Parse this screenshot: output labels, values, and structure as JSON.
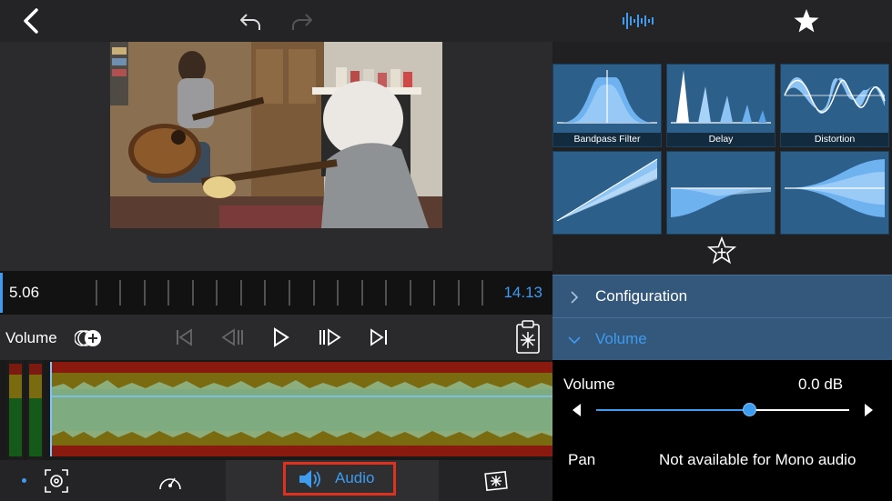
{
  "topbar": {
    "back_icon": "chevron-left-icon",
    "undo_icon": "undo-icon",
    "redo_icon": "redo-icon",
    "audio_fx_icon": "waveform-icon",
    "favorite_icon": "star-icon"
  },
  "effects": {
    "tiles": [
      {
        "label": "Bandpass Filter",
        "icon": "bandpass-graph"
      },
      {
        "label": "Delay",
        "icon": "delay-graph"
      },
      {
        "label": "Distortion",
        "icon": "distortion-graph"
      },
      {
        "label": "",
        "icon": "compressor-graph"
      },
      {
        "label": "",
        "icon": "fade-graph"
      },
      {
        "label": "",
        "icon": "spread-graph"
      }
    ],
    "add_favorite_icon": "star-plus-icon"
  },
  "timeline": {
    "start_time": "5.06",
    "end_time": "14.13"
  },
  "controls": {
    "volume_label": "Volume",
    "volume_toggle_icon": "add-volume-icon",
    "skip_start_icon": "skip-to-start-icon",
    "step_back_icon": "step-back-icon",
    "play_icon": "play-icon",
    "step_forward_icon": "step-forward-icon",
    "skip_end_icon": "skip-to-end-icon",
    "clipboard_icon": "clipboard-icon"
  },
  "bottombar": {
    "tabs": [
      {
        "icon": "framing-icon",
        "label": ""
      },
      {
        "icon": "speed-icon",
        "label": ""
      },
      {
        "icon": "speaker-icon",
        "label": "Audio"
      },
      {
        "icon": "effects-icon",
        "label": ""
      }
    ]
  },
  "settings": {
    "sections": [
      {
        "label": "Configuration",
        "expanded": false
      },
      {
        "label": "Volume",
        "expanded": true
      }
    ],
    "volume": {
      "label": "Volume",
      "value": "0.0 dB",
      "level": 0.5
    },
    "pan": {
      "label": "Pan",
      "value": "Not available for Mono audio"
    }
  },
  "colors": {
    "accent": "#3d9bf0",
    "highlight": "#e0301e",
    "section_bg": "#34587c",
    "tile_bg": "#2c5f8a"
  }
}
